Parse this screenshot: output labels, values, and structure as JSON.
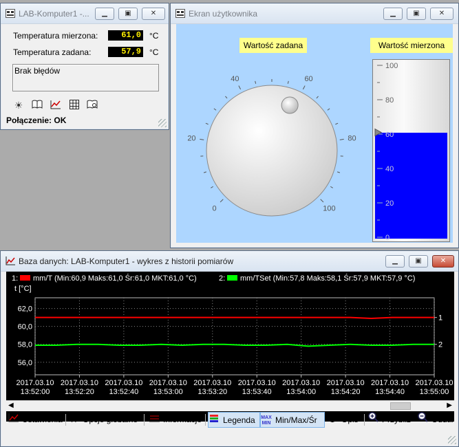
{
  "win1": {
    "title": "LAB-Komputer1 -...",
    "measured_label": "Temperatura mierzona:",
    "measured_value": "61,0",
    "set_label": "Temperatura zadana:",
    "set_value": "57,9",
    "unit": "°C",
    "message": "Brak błędów",
    "status": "Połączenie: OK"
  },
  "win2": {
    "title": "Ekran użytkownika",
    "set_label": "Wartość zadana",
    "measured_label": "Wartość mierzona",
    "knob_ticks": [
      "0",
      "20",
      "40",
      "60",
      "80",
      "100"
    ],
    "knob_value": 58,
    "bar_ticks": [
      "100",
      "80",
      "60",
      "40",
      "20",
      "0"
    ],
    "bar_value": 61,
    "bar_color": "#0000ff"
  },
  "win3": {
    "title": "Baza danych: LAB-Komputer1 - wykres z historii pomiarów",
    "toolbar": {
      "settings": "Ustawienia",
      "global": "Opcje globalne",
      "info": "Informacje",
      "legend": "Legenda",
      "minmax": "Min/Max/Śr",
      "desc": "Opis",
      "zoom_in": "Przybliż",
      "zoom_out": "Oddal"
    }
  },
  "chart_data": {
    "type": "line",
    "ylabel": "t [°C]",
    "ylim": [
      54.6,
      63.2
    ],
    "yticks": [
      "62,0",
      "60,0",
      "58,0",
      "56,0"
    ],
    "xticks": [
      [
        "2017.03.10",
        "13:52:00"
      ],
      [
        "2017.03.10",
        "13:52:20"
      ],
      [
        "2017.03.10",
        "13:52:40"
      ],
      [
        "2017.03.10",
        "13:53:00"
      ],
      [
        "2017.03.10",
        "13:53:20"
      ],
      [
        "2017.03.10",
        "13:53:40"
      ],
      [
        "2017.03.10",
        "13:54:00"
      ],
      [
        "2017.03.10",
        "13:54:20"
      ],
      [
        "2017.03.10",
        "13:54:40"
      ],
      [
        "2017.03.10",
        "13:55:00"
      ]
    ],
    "grid": true,
    "series": [
      {
        "name": "mm/T",
        "legend": "1:",
        "stats": "(Min:60,9 Maks:61,0 Śr:61,0 MKT:61,0 °C)",
        "color": "#ff0000",
        "end_label": "1",
        "values": [
          61.0,
          61.0,
          61.0,
          61.0,
          61.0,
          61.0,
          61.0,
          61.0,
          61.0,
          61.0,
          61.0,
          61.0,
          61.0,
          61.0,
          61.0,
          61.0,
          60.9,
          61.0,
          61.0,
          61.0
        ]
      },
      {
        "name": "mm/TSet",
        "legend": "2:",
        "stats": "(Min:57,8 Maks:58,1 Śr:57,9 MKT:57,9 °C)",
        "color": "#00ff00",
        "end_label": "2",
        "values": [
          57.9,
          57.9,
          58.0,
          58.0,
          57.9,
          57.9,
          58.0,
          57.9,
          58.0,
          58.0,
          57.9,
          57.9,
          58.0,
          57.8,
          57.9,
          58.0,
          57.9,
          57.9,
          58.0,
          58.0
        ]
      }
    ]
  }
}
